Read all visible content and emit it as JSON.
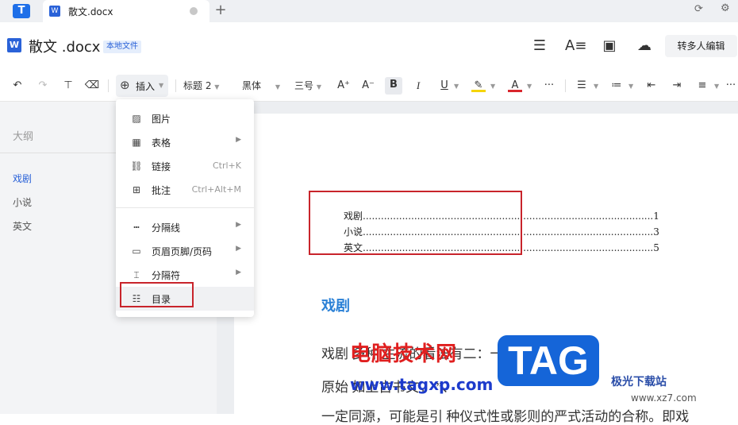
{
  "tabbar": {
    "logo": "T",
    "tab_label": "散文.docx",
    "tab_icon": "W",
    "new_tab": "+",
    "icons": [
      "sync-icon",
      "settings-icon"
    ]
  },
  "titlebar": {
    "doc_icon": "W",
    "title": "散文 .docx",
    "badge": "本地文件",
    "collab_button": "转多人编辑",
    "icons": [
      "menu-icon",
      "text-format-icon",
      "present-icon",
      "upload-cloud-icon"
    ]
  },
  "toolbar": {
    "insert_label": "插入",
    "heading_style": "标题 2",
    "font": "黑体",
    "font_size": "三号",
    "bold": "B",
    "italic": "I",
    "underline": "U",
    "font_color": "A",
    "more": "···",
    "colors": {
      "highlight": "#f5d50a",
      "font": "#d9262d"
    }
  },
  "sidebar": {
    "title": "大纲",
    "items": [
      "戏剧",
      "小说",
      "英文"
    ]
  },
  "insert_menu": {
    "items": [
      {
        "label": "图片",
        "icon": "image-icon"
      },
      {
        "label": "表格",
        "icon": "table-icon",
        "submenu": true
      },
      {
        "label": "链接",
        "icon": "link-icon",
        "shortcut": "Ctrl+K"
      },
      {
        "label": "批注",
        "icon": "comment-icon",
        "shortcut": "Ctrl+Alt+M"
      },
      {
        "label": "分隔线",
        "icon": "divider-icon",
        "submenu": true
      },
      {
        "label": "页眉页脚/页码",
        "icon": "header-footer-icon",
        "submenu": true
      },
      {
        "label": "分隔符",
        "icon": "separator-icon",
        "submenu": true
      },
      {
        "label": "目录",
        "icon": "toc-icon"
      }
    ]
  },
  "document": {
    "toc": [
      {
        "title": "戏剧",
        "page": "1"
      },
      {
        "title": "小说",
        "page": "3"
      },
      {
        "title": "英文",
        "page": "5"
      }
    ],
    "heading": "戏剧",
    "para1": "戏剧                              多种                    主流的看法有二：一为",
    "para2": "原始                                              如上古书文，        ”、",
    "para3": "一定同源，可能是引   种仪式性或影则的严式活动的合称。即戏"
  },
  "watermark": {
    "line1": "电脑技术网",
    "line2": "www.tagxp.com",
    "logo": "TAG",
    "site": "极光下载站",
    "site_url": "www.xz7.com"
  },
  "accent": {
    "blue": "#2a62d8",
    "red_box": "#c8242b",
    "heading": "#2a80d6"
  }
}
